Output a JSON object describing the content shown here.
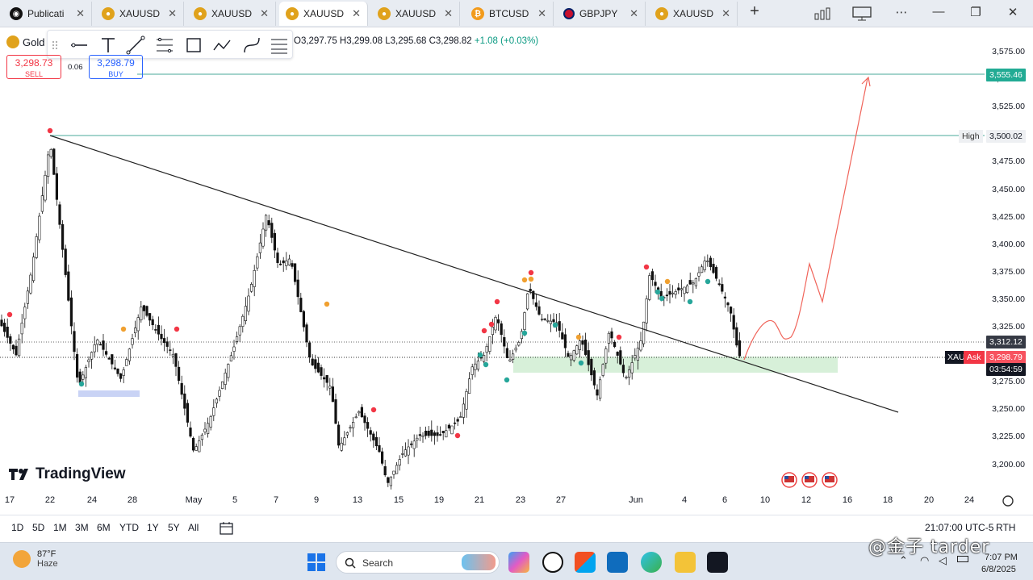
{
  "tabs": [
    {
      "label": "Publicati",
      "icon": "tradingview-publication-icon",
      "active": false
    },
    {
      "label": "XAUUSD",
      "icon": "gold-icon",
      "active": false
    },
    {
      "label": "XAUUSD",
      "icon": "gold-icon",
      "active": false
    },
    {
      "label": "XAUUSD",
      "icon": "gold-icon",
      "active": true
    },
    {
      "label": "XAUUSD",
      "icon": "gold-icon",
      "active": false
    },
    {
      "label": "BTCUSD",
      "icon": "bitcoin-icon",
      "active": false
    },
    {
      "label": "GBPJPY",
      "icon": "uk-flag-icon",
      "active": false
    },
    {
      "label": "XAUUSD",
      "icon": "gold-icon",
      "active": false
    }
  ],
  "new_tab_icon": "+",
  "window_controls": {
    "more": "⋯",
    "minimize": "—",
    "maximize": "❐",
    "close": "✕"
  },
  "symbol": {
    "name": "Gold",
    "icon": "gold-icon"
  },
  "ohlc": {
    "o": "O3,297.75",
    "h": "H3,299.08",
    "l": "L3,295.68",
    "c": "C3,298.82",
    "change": "+1.08 (+0.03%)"
  },
  "trade": {
    "sell_price": "3,298.73",
    "sell_label": "SELL",
    "spread": "0.06",
    "buy_price": "3,298.79",
    "buy_label": "BUY"
  },
  "price_axis": {
    "ticks": [
      "3,575.00",
      "3,550.00",
      "3,525.00",
      "3,500.00",
      "3,475.00",
      "3,450.00",
      "3,425.00",
      "3,400.00",
      "3,375.00",
      "3,350.00",
      "3,325.00",
      "3,300.00",
      "3,275.00",
      "3,250.00",
      "3,225.00",
      "3,200.00"
    ],
    "labels": {
      "target": "3,555.46",
      "high_tag": "High",
      "high": "3,500.02",
      "level": "3,312.12",
      "ask_symbol": "XAU",
      "ask_tag": "Ask",
      "ask": "3,298.79",
      "countdown": "03:54:59"
    }
  },
  "time_axis": [
    "17",
    "22",
    "24",
    "28",
    "May",
    "5",
    "7",
    "9",
    "13",
    "15",
    "19",
    "21",
    "23",
    "27",
    "Jun",
    "4",
    "6",
    "10",
    "12",
    "16",
    "18",
    "20",
    "24"
  ],
  "branding": "TradingView",
  "ranges": [
    "1D",
    "5D",
    "1M",
    "3M",
    "6M",
    "YTD",
    "1Y",
    "5Y",
    "All"
  ],
  "timezone": "21:07:00 UTC-5",
  "session": "RTH",
  "colors": {
    "up": "#089981",
    "down": "#f23645",
    "accent": "#2962ff",
    "hline": "#4aa89a",
    "zone": "#d7f0d9"
  },
  "taskbar": {
    "temp": "87°F",
    "condition": "Haze",
    "search_placeholder": "Search",
    "time": "7:07 PM",
    "date": "6/8/2025"
  },
  "watermark": "@金子 tarder"
}
